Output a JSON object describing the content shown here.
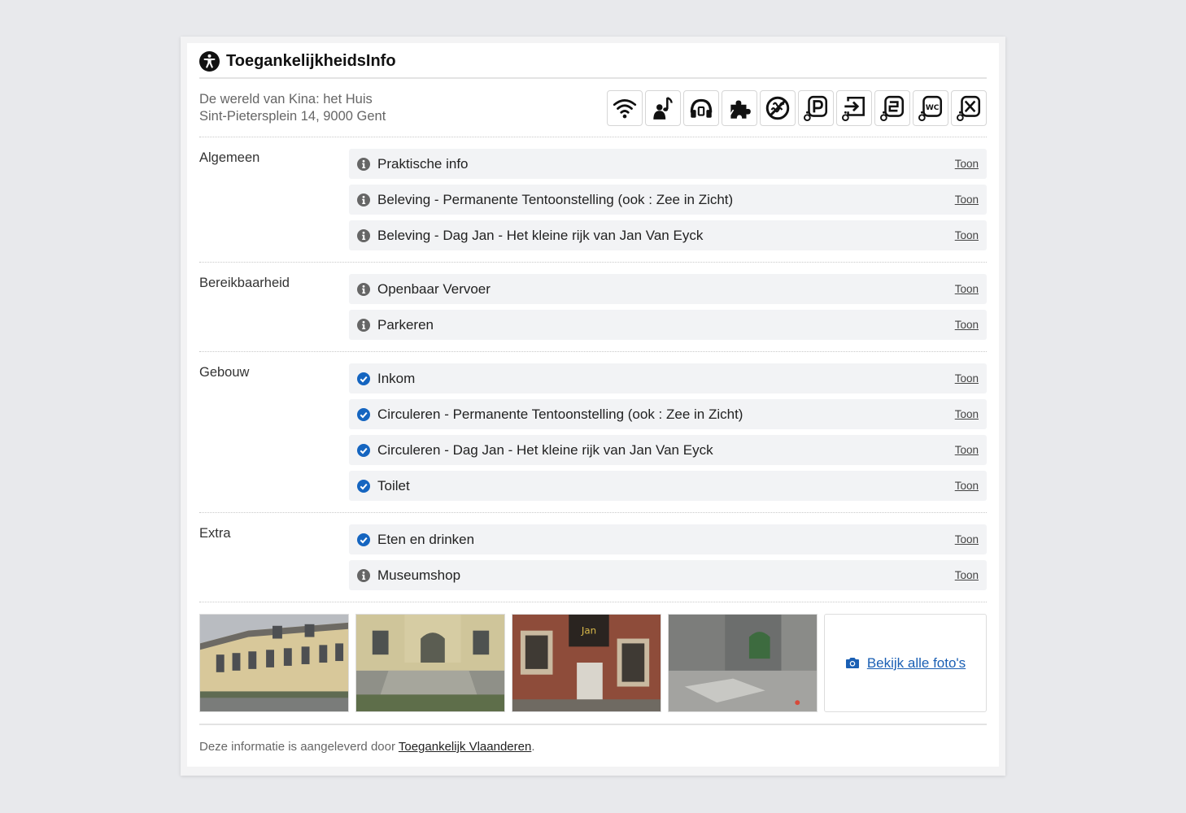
{
  "header": {
    "title": "ToegankelijkheidsInfo"
  },
  "venue": {
    "name": "De wereld van Kina: het Huis",
    "address": "Sint-Pietersplein 14, 9000 Gent"
  },
  "feature_icons": [
    "wifi-icon",
    "audio-guide-icon",
    "headphones-icon",
    "puzzle-icon",
    "no-smell-icon",
    "accessible-parking-icon",
    "accessible-entrance-icon",
    "accessible-elevator-icon",
    "accessible-toilet-icon",
    "accessible-restaurant-icon"
  ],
  "sections": [
    {
      "label": "Algemeen",
      "items": [
        {
          "text": "Praktische info",
          "status": "info",
          "action": "Toon"
        },
        {
          "text": "Beleving - Permanente Tentoonstelling (ook : Zee in Zicht)",
          "status": "info",
          "action": "Toon"
        },
        {
          "text": "Beleving - Dag Jan - Het kleine rijk van Jan Van Eyck",
          "status": "info",
          "action": "Toon"
        }
      ]
    },
    {
      "label": "Bereikbaarheid",
      "items": [
        {
          "text": "Openbaar Vervoer",
          "status": "info",
          "action": "Toon"
        },
        {
          "text": "Parkeren",
          "status": "info",
          "action": "Toon"
        }
      ]
    },
    {
      "label": "Gebouw",
      "items": [
        {
          "text": "Inkom",
          "status": "check",
          "action": "Toon"
        },
        {
          "text": "Circuleren - Permanente Tentoonstelling (ook : Zee in Zicht)",
          "status": "check",
          "action": "Toon"
        },
        {
          "text": "Circuleren - Dag Jan - Het kleine rijk van Jan Van Eyck",
          "status": "check",
          "action": "Toon"
        },
        {
          "text": "Toilet",
          "status": "check",
          "action": "Toon"
        }
      ]
    },
    {
      "label": "Extra",
      "items": [
        {
          "text": "Eten en drinken",
          "status": "check",
          "action": "Toon"
        },
        {
          "text": "Museumshop",
          "status": "info",
          "action": "Toon"
        }
      ]
    }
  ],
  "photos": {
    "count": 4,
    "view_all_label": "Bekijk alle foto's"
  },
  "footer": {
    "prefix": "Deze informatie is aangeleverd door ",
    "source": "Toegankelijk Vlaanderen",
    "suffix": "."
  },
  "colors": {
    "check": "#1565c0",
    "info": "#666666",
    "link": "#1a5fb4"
  }
}
